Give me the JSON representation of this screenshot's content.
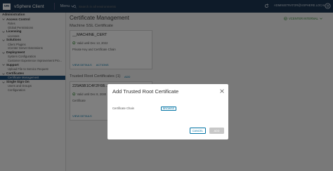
{
  "header": {
    "logo_text": "vm",
    "app_name": "vSphere Client",
    "menu_label": "Menu",
    "search_placeholder": "Search in all environments",
    "user": "ADMINISTRATOR@VSPHERE.LOCAL"
  },
  "sidebar": {
    "sections": [
      {
        "label": "Administration",
        "items": []
      },
      {
        "label": "Access Control",
        "items": [
          "Roles",
          "Global Permissions"
        ]
      },
      {
        "label": "Licensing",
        "items": [
          "Licenses"
        ]
      },
      {
        "label": "Solutions",
        "items": [
          "Client Plugins",
          "vCenter Server Extensions"
        ]
      },
      {
        "label": "Deployment",
        "items": [
          "System Configuration",
          "Customer Experience Improvement Pro..."
        ]
      },
      {
        "label": "Support",
        "items": [
          "Upload File to Service Request"
        ]
      },
      {
        "label": "Certificates",
        "items": [
          "Certificate Management"
        ]
      },
      {
        "label": "Single Sign On",
        "items": [
          "Users and Groups",
          "Configuration"
        ]
      }
    ],
    "active_item": "Certificate Management"
  },
  "main": {
    "title": "Certificate Management",
    "update_label": "VCENTER INTERNAL",
    "machine_section": "Machine SSL Certificate",
    "machine_card": {
      "title": "__MACHINE_CERT",
      "valid": "Valid until Dec 13, 2022",
      "desc": "Private Key and Certificate Chain",
      "actions": [
        "VIEW DETAILS",
        "ACTIONS"
      ]
    },
    "trusted_section": "Trusted Root Certificates",
    "trusted_count": "(1)",
    "add_label": "ADD",
    "trusted_card": {
      "title": "229A5B1C4F2F6B...",
      "valid": "Valid until Dec 8, 2030",
      "desc": "Certificate",
      "actions": [
        "VIEW DETAILS"
      ]
    }
  },
  "modal": {
    "title": "Add Trusted Root Certificate",
    "field_label": "Certificate Chain",
    "browse_label": "BROWSE",
    "cancel_label": "CANCEL",
    "add_label": "ADD"
  },
  "colors": {
    "header_bg": "#1d3752",
    "active_nav": "#1f4e79",
    "link": "#0072a3",
    "success": "#3c8b3c",
    "disabled_button": "#c8c8c8"
  }
}
